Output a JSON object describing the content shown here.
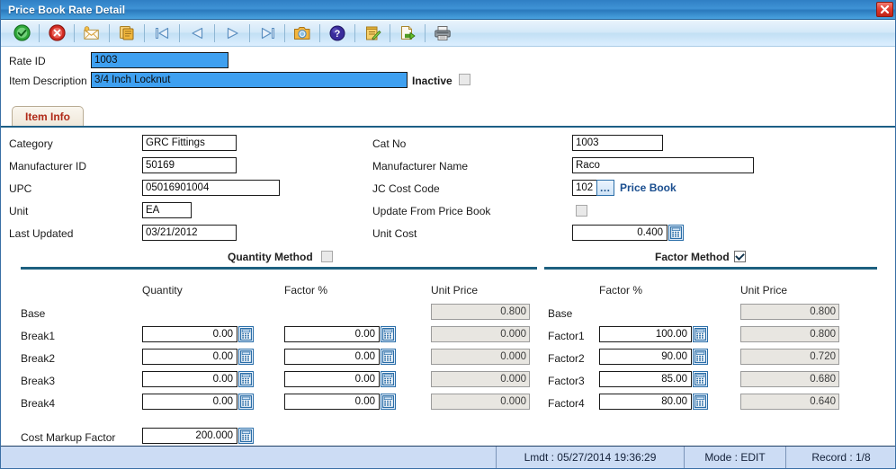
{
  "window": {
    "title": "Price Book Rate Detail",
    "close_icon": "close-icon"
  },
  "toolbar": {
    "buttons": [
      {
        "name": "accept-button",
        "icon": "green-check-circle-icon",
        "label": "Accept"
      },
      {
        "name": "cancel-button",
        "icon": "red-x-circle-icon",
        "label": "Cancel"
      },
      {
        "name": "new-record-button",
        "icon": "new-card-icon",
        "label": "New"
      },
      {
        "name": "copy-button",
        "icon": "copy-pages-icon",
        "label": "Copy"
      },
      {
        "name": "first-record-button",
        "icon": "first-record-icon",
        "label": "First"
      },
      {
        "name": "previous-record-button",
        "icon": "previous-record-icon",
        "label": "Previous"
      },
      {
        "name": "next-record-button",
        "icon": "next-record-icon",
        "label": "Next"
      },
      {
        "name": "last-record-button",
        "icon": "last-record-icon",
        "label": "Last"
      },
      {
        "name": "find-button",
        "icon": "camera-search-icon",
        "label": "Find"
      },
      {
        "name": "help-button",
        "icon": "question-mark-icon",
        "label": "Help"
      },
      {
        "name": "edit-button",
        "icon": "notepad-pencil-icon",
        "label": "Edit"
      },
      {
        "name": "export-button",
        "icon": "export-page-icon",
        "label": "Export"
      },
      {
        "name": "print-button",
        "icon": "printer-icon",
        "label": "Print"
      }
    ]
  },
  "header": {
    "rate_id_label": "Rate ID",
    "rate_id_value": "1003",
    "item_description_label": "Item Description",
    "item_description_value": "3/4 Inch Locknut",
    "inactive_label": "Inactive",
    "inactive_checked": false
  },
  "tabs": [
    {
      "label": "Item Info",
      "active": true
    }
  ],
  "item_info": {
    "left": [
      {
        "label": "Category",
        "value": "GRC Fittings"
      },
      {
        "label": "Manufacturer ID",
        "value": "50169"
      },
      {
        "label": "UPC",
        "value": "05016901004"
      },
      {
        "label": "Unit",
        "value": "EA"
      },
      {
        "label": "Last Updated",
        "value": "03/21/2012"
      }
    ],
    "right": {
      "cat_no_label": "Cat No",
      "cat_no_value": "1003",
      "manufacturer_name_label": "Manufacturer Name",
      "manufacturer_name_value": "Raco",
      "jc_cost_code_label": "JC Cost Code",
      "jc_cost_code_value": "102",
      "price_book_link": "Price Book",
      "update_from_price_book_label": "Update From Price Book",
      "update_from_price_book_checked": false,
      "unit_cost_label": "Unit Cost",
      "unit_cost_value": "0.400"
    }
  },
  "quantity_method": {
    "title": "Quantity Method",
    "checked": false,
    "columns": [
      "Quantity",
      "Factor %",
      "Unit Price"
    ],
    "rows": [
      {
        "label": "Base",
        "quantity": "",
        "factor": "",
        "unit_price": "0.800",
        "editable": false
      },
      {
        "label": "Break1",
        "quantity": "0.00",
        "factor": "0.00",
        "unit_price": "0.000",
        "editable": true
      },
      {
        "label": "Break2",
        "quantity": "0.00",
        "factor": "0.00",
        "unit_price": "0.000",
        "editable": true
      },
      {
        "label": "Break3",
        "quantity": "0.00",
        "factor": "0.00",
        "unit_price": "0.000",
        "editable": true
      },
      {
        "label": "Break4",
        "quantity": "0.00",
        "factor": "0.00",
        "unit_price": "0.000",
        "editable": true
      }
    ],
    "cost_markup_factor_label": "Cost Markup Factor",
    "cost_markup_factor_value": "200.000"
  },
  "factor_method": {
    "title": "Factor Method",
    "checked": true,
    "columns": [
      "Factor %",
      "Unit Price"
    ],
    "rows": [
      {
        "label": "Base",
        "factor": "",
        "unit_price": "0.800",
        "editable": false
      },
      {
        "label": "Factor1",
        "factor": "100.00",
        "unit_price": "0.800",
        "editable": true
      },
      {
        "label": "Factor2",
        "factor": "90.00",
        "unit_price": "0.720",
        "editable": true
      },
      {
        "label": "Factor3",
        "factor": "85.00",
        "unit_price": "0.680",
        "editable": true
      },
      {
        "label": "Factor4",
        "factor": "80.00",
        "unit_price": "0.640",
        "editable": true
      }
    ]
  },
  "statusbar": {
    "lmdt": "Lmdt : 05/27/2014 19:36:29",
    "mode": "Mode : EDIT",
    "record": "Record : 1/8"
  },
  "colors": {
    "titlebar": "#3f93d6",
    "selected_field": "#3fa0f0",
    "tab_text": "#b02a18",
    "rule": "#1d6080",
    "link": "#1a4e8f",
    "statusbar": "#ccdcf4"
  }
}
